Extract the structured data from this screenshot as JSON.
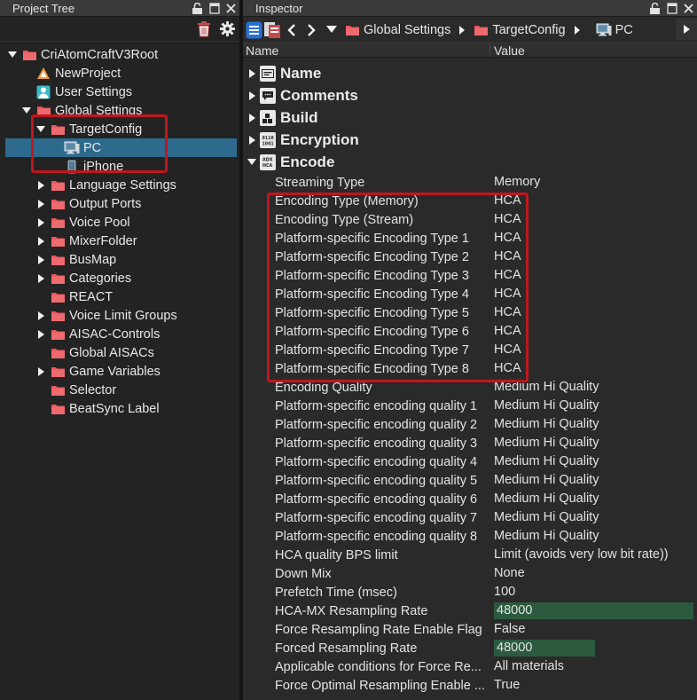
{
  "left_panel": {
    "title": "Project Tree",
    "tree": [
      {
        "label": "CriAtomCraftV3Root",
        "icon": "folder-icon",
        "indent": 0,
        "expanded": true
      },
      {
        "label": "NewProject",
        "icon": "warning-project-icon",
        "indent": 1
      },
      {
        "label": "User Settings",
        "icon": "user-settings-icon",
        "indent": 1
      },
      {
        "label": "Global Settings",
        "icon": "folder-icon",
        "indent": 1,
        "expanded": true
      },
      {
        "label": "TargetConfig",
        "icon": "folder-icon",
        "indent": 2,
        "expanded": true
      },
      {
        "label": "PC",
        "icon": "pc-icon",
        "indent": 3,
        "selected": true
      },
      {
        "label": "iPhone",
        "icon": "iphone-icon",
        "indent": 3
      },
      {
        "label": "Language Settings",
        "icon": "folder-icon",
        "indent": 2,
        "collapsed": true
      },
      {
        "label": "Output Ports",
        "icon": "folder-icon",
        "indent": 2,
        "collapsed": true
      },
      {
        "label": "Voice Pool",
        "icon": "folder-icon",
        "indent": 2,
        "collapsed": true
      },
      {
        "label": "MixerFolder",
        "icon": "folder-icon",
        "indent": 2,
        "collapsed": true
      },
      {
        "label": "BusMap",
        "icon": "folder-icon",
        "indent": 2,
        "collapsed": true
      },
      {
        "label": "Categories",
        "icon": "folder-icon",
        "indent": 2,
        "collapsed": true
      },
      {
        "label": "REACT",
        "icon": "folder-icon",
        "indent": 2
      },
      {
        "label": "Voice Limit Groups",
        "icon": "folder-icon",
        "indent": 2,
        "collapsed": true
      },
      {
        "label": "AISAC-Controls",
        "icon": "folder-icon",
        "indent": 2,
        "collapsed": true
      },
      {
        "label": "Global AISACs",
        "icon": "folder-icon",
        "indent": 2
      },
      {
        "label": "Game Variables",
        "icon": "folder-icon",
        "indent": 2,
        "collapsed": true
      },
      {
        "label": "Selector",
        "icon": "folder-icon",
        "indent": 2
      },
      {
        "label": "BeatSync Label",
        "icon": "folder-icon",
        "indent": 2
      }
    ]
  },
  "right_panel": {
    "title": "Inspector",
    "breadcrumb": [
      {
        "label": "Global Settings",
        "icon": "folder-icon"
      },
      {
        "label": "TargetConfig",
        "icon": "folder-icon"
      },
      {
        "label": "PC",
        "icon": "pc-icon"
      }
    ],
    "columns": {
      "name": "Name",
      "value": "Value"
    },
    "categories": [
      {
        "label": "Name",
        "icon": "name-tag-icon",
        "expanded": false
      },
      {
        "label": "Comments",
        "icon": "comment-icon",
        "expanded": false
      },
      {
        "label": "Build",
        "icon": "build-icon",
        "expanded": false
      },
      {
        "label": "Encryption",
        "icon": "encryption-icon",
        "expanded": false
      },
      {
        "label": "Encode",
        "icon": "encode-hca-icon",
        "expanded": true
      }
    ],
    "properties": [
      {
        "name": "Streaming Type",
        "value": "Memory"
      },
      {
        "name": "Encoding Type (Memory)",
        "value": "HCA"
      },
      {
        "name": "Encoding Type (Stream)",
        "value": "HCA"
      },
      {
        "name": "Platform-specific Encoding Type 1",
        "value": "HCA"
      },
      {
        "name": "Platform-specific Encoding Type 2",
        "value": "HCA"
      },
      {
        "name": "Platform-specific Encoding Type 3",
        "value": "HCA"
      },
      {
        "name": "Platform-specific Encoding Type 4",
        "value": "HCA"
      },
      {
        "name": "Platform-specific Encoding Type 5",
        "value": "HCA"
      },
      {
        "name": "Platform-specific Encoding Type 6",
        "value": "HCA"
      },
      {
        "name": "Platform-specific Encoding Type 7",
        "value": "HCA"
      },
      {
        "name": "Platform-specific Encoding Type 8",
        "value": "HCA"
      },
      {
        "name": "Encoding Quality",
        "value": "Medium Hi Quality"
      },
      {
        "name": "Platform-specific encoding quality 1",
        "value": "Medium Hi Quality"
      },
      {
        "name": "Platform-specific encoding quality 2",
        "value": "Medium Hi Quality"
      },
      {
        "name": "Platform-specific encoding quality 3",
        "value": "Medium Hi Quality"
      },
      {
        "name": "Platform-specific encoding quality 4",
        "value": "Medium Hi Quality"
      },
      {
        "name": "Platform-specific encoding quality 5",
        "value": "Medium Hi Quality"
      },
      {
        "name": "Platform-specific encoding quality 6",
        "value": "Medium Hi Quality"
      },
      {
        "name": "Platform-specific encoding quality 7",
        "value": "Medium Hi Quality"
      },
      {
        "name": "Platform-specific encoding quality 8",
        "value": "Medium Hi Quality"
      },
      {
        "name": "HCA quality BPS limit",
        "value": "Limit (avoids very low bit rate))"
      },
      {
        "name": "Down Mix",
        "value": "None"
      },
      {
        "name": "Prefetch Time (msec)",
        "value": "100"
      },
      {
        "name": "HCA-MX Resampling Rate",
        "value": "48000",
        "editor": "wide"
      },
      {
        "name": "Force Resampling Rate Enable Flag",
        "value": "False"
      },
      {
        "name": "Forced Resampling Rate",
        "value": "48000",
        "editor": "short"
      },
      {
        "name": "Applicable conditions for Force Re...",
        "value": "All materials"
      },
      {
        "name": "Force Optimal Resampling Enable ...",
        "value": "True"
      }
    ]
  },
  "colors": {
    "selection": "#2e6a8e",
    "highlight_box": "#c0161e",
    "folder": "#e8555a",
    "edit_field": "#2c5a3e"
  }
}
